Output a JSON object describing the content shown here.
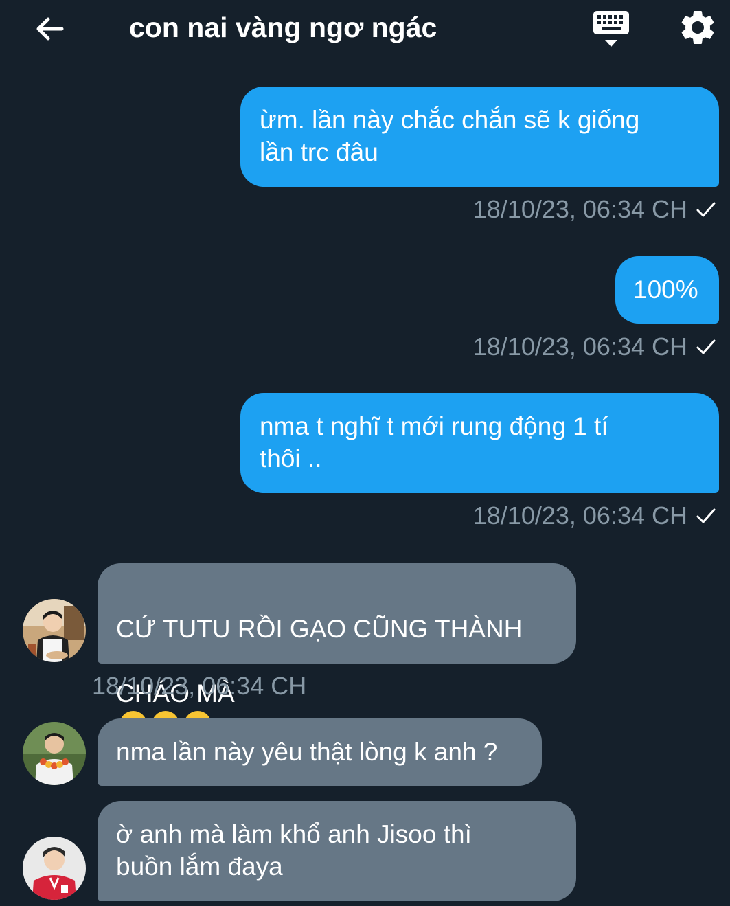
{
  "header": {
    "title": "con nai vàng ngơ ngác",
    "back_icon": "arrow-left-icon",
    "keyboard_icon": "keyboard-icon",
    "settings_icon": "gear-icon"
  },
  "colors": {
    "background": "#15202b",
    "outgoing_bubble": "#1da1f2",
    "incoming_bubble": "#667786",
    "timestamp": "#8899a6"
  },
  "messages": [
    {
      "direction": "out",
      "text": "ừm.  lần này chắc chắn sẽ k giống\nlần trc đâu",
      "timestamp": "18/10/23, 06:34 CH",
      "status_icon": "check-icon"
    },
    {
      "direction": "out",
      "text": "100%",
      "timestamp": "18/10/23, 06:34 CH",
      "status_icon": "check-icon"
    },
    {
      "direction": "out",
      "text": "nma t nghĩ t mới rung động 1 tí\nthôi ..",
      "timestamp": "18/10/23, 06:34 CH",
      "status_icon": "check-icon"
    },
    {
      "direction": "in",
      "text_line1": "CỨ TUTU RỒI GẠO CŨNG THÀNH",
      "text_line2": "CHÁO MÀ",
      "emoji": "sunglasses-emoji",
      "emoji_count": 3,
      "timestamp": "18/10/23, 06:34 CH",
      "avatar": "avatar-1"
    },
    {
      "direction": "in",
      "text": "nma lần này yêu thật lòng k anh ?",
      "avatar": "avatar-2"
    },
    {
      "direction": "in",
      "text": "ờ anh mà làm khổ anh Jisoo thì\nbuồn lắm đaya",
      "avatar": "avatar-3"
    }
  ]
}
